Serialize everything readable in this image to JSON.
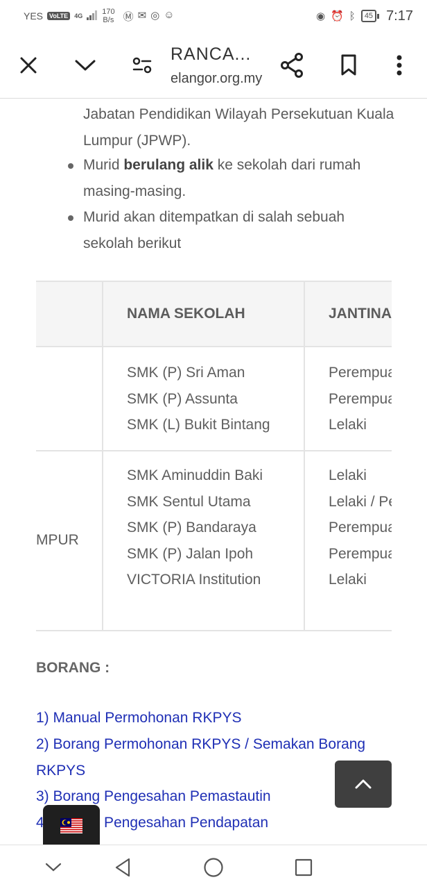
{
  "status_bar": {
    "carrier": "YES",
    "volte": "VoLTE",
    "network": "4G",
    "data_rate_value": "170",
    "data_rate_unit": "B/s",
    "battery": "45",
    "time": "7:17"
  },
  "toolbar": {
    "title": "RANCA...",
    "url": "elangor.org.my"
  },
  "content": {
    "para_continued": "Jabatan Pendidikan Wilayah Persekutuan Kuala Lumpur (JPWP).",
    "bullet1_prefix": "Murid ",
    "bullet1_bold": "berulang alik",
    "bullet1_suffix": " ke sekolah dari rumah masing-masing.",
    "bullet2": "Murid akan ditempatkan di salah sebuah sekolah berikut"
  },
  "table": {
    "headers": [
      "",
      "NAMA SEKOLAH",
      "JANTINA"
    ],
    "rows": [
      {
        "zone": "",
        "schools": [
          "SMK (P) Sri Aman",
          "SMK (P) Assunta",
          "SMK (L) Bukit Bintang"
        ],
        "genders": [
          "Perempuan",
          "Perempuan",
          "Lelaki"
        ]
      },
      {
        "zone": "MPUR",
        "schools": [
          "SMK Aminuddin Baki",
          "SMK Sentul Utama",
          "SMK (P) Bandaraya",
          "SMK (P) Jalan Ipoh",
          "VICTORIA Institution"
        ],
        "genders": [
          "Lelaki",
          "Lelaki / Pe",
          "Perempuan",
          "Perempuan",
          "Lelaki"
        ]
      }
    ]
  },
  "borang": {
    "heading": "BORANG :",
    "links": [
      "1) Manual Permohonan RKPYS",
      "2) Borang Permohonan RKPYS /  Semakan Borang RKPYS",
      "3) Borang Pengesahan Pemastautin",
      "4) Borang Pengesahan Pendapatan"
    ]
  },
  "colors": {
    "link": "#1f2fb5",
    "table_border": "#e3e3e3",
    "header_bg": "#f5f5f5",
    "scroll_button": "#3f3f3f"
  },
  "icons": {
    "close": "close-icon",
    "collapse": "chevron-down-icon",
    "settings": "page-settings-icon",
    "share": "share-icon",
    "bookmark": "bookmark-icon",
    "menu": "more-vert-icon",
    "scroll_top": "chevron-up-icon",
    "language": "malaysia-flag-icon"
  }
}
